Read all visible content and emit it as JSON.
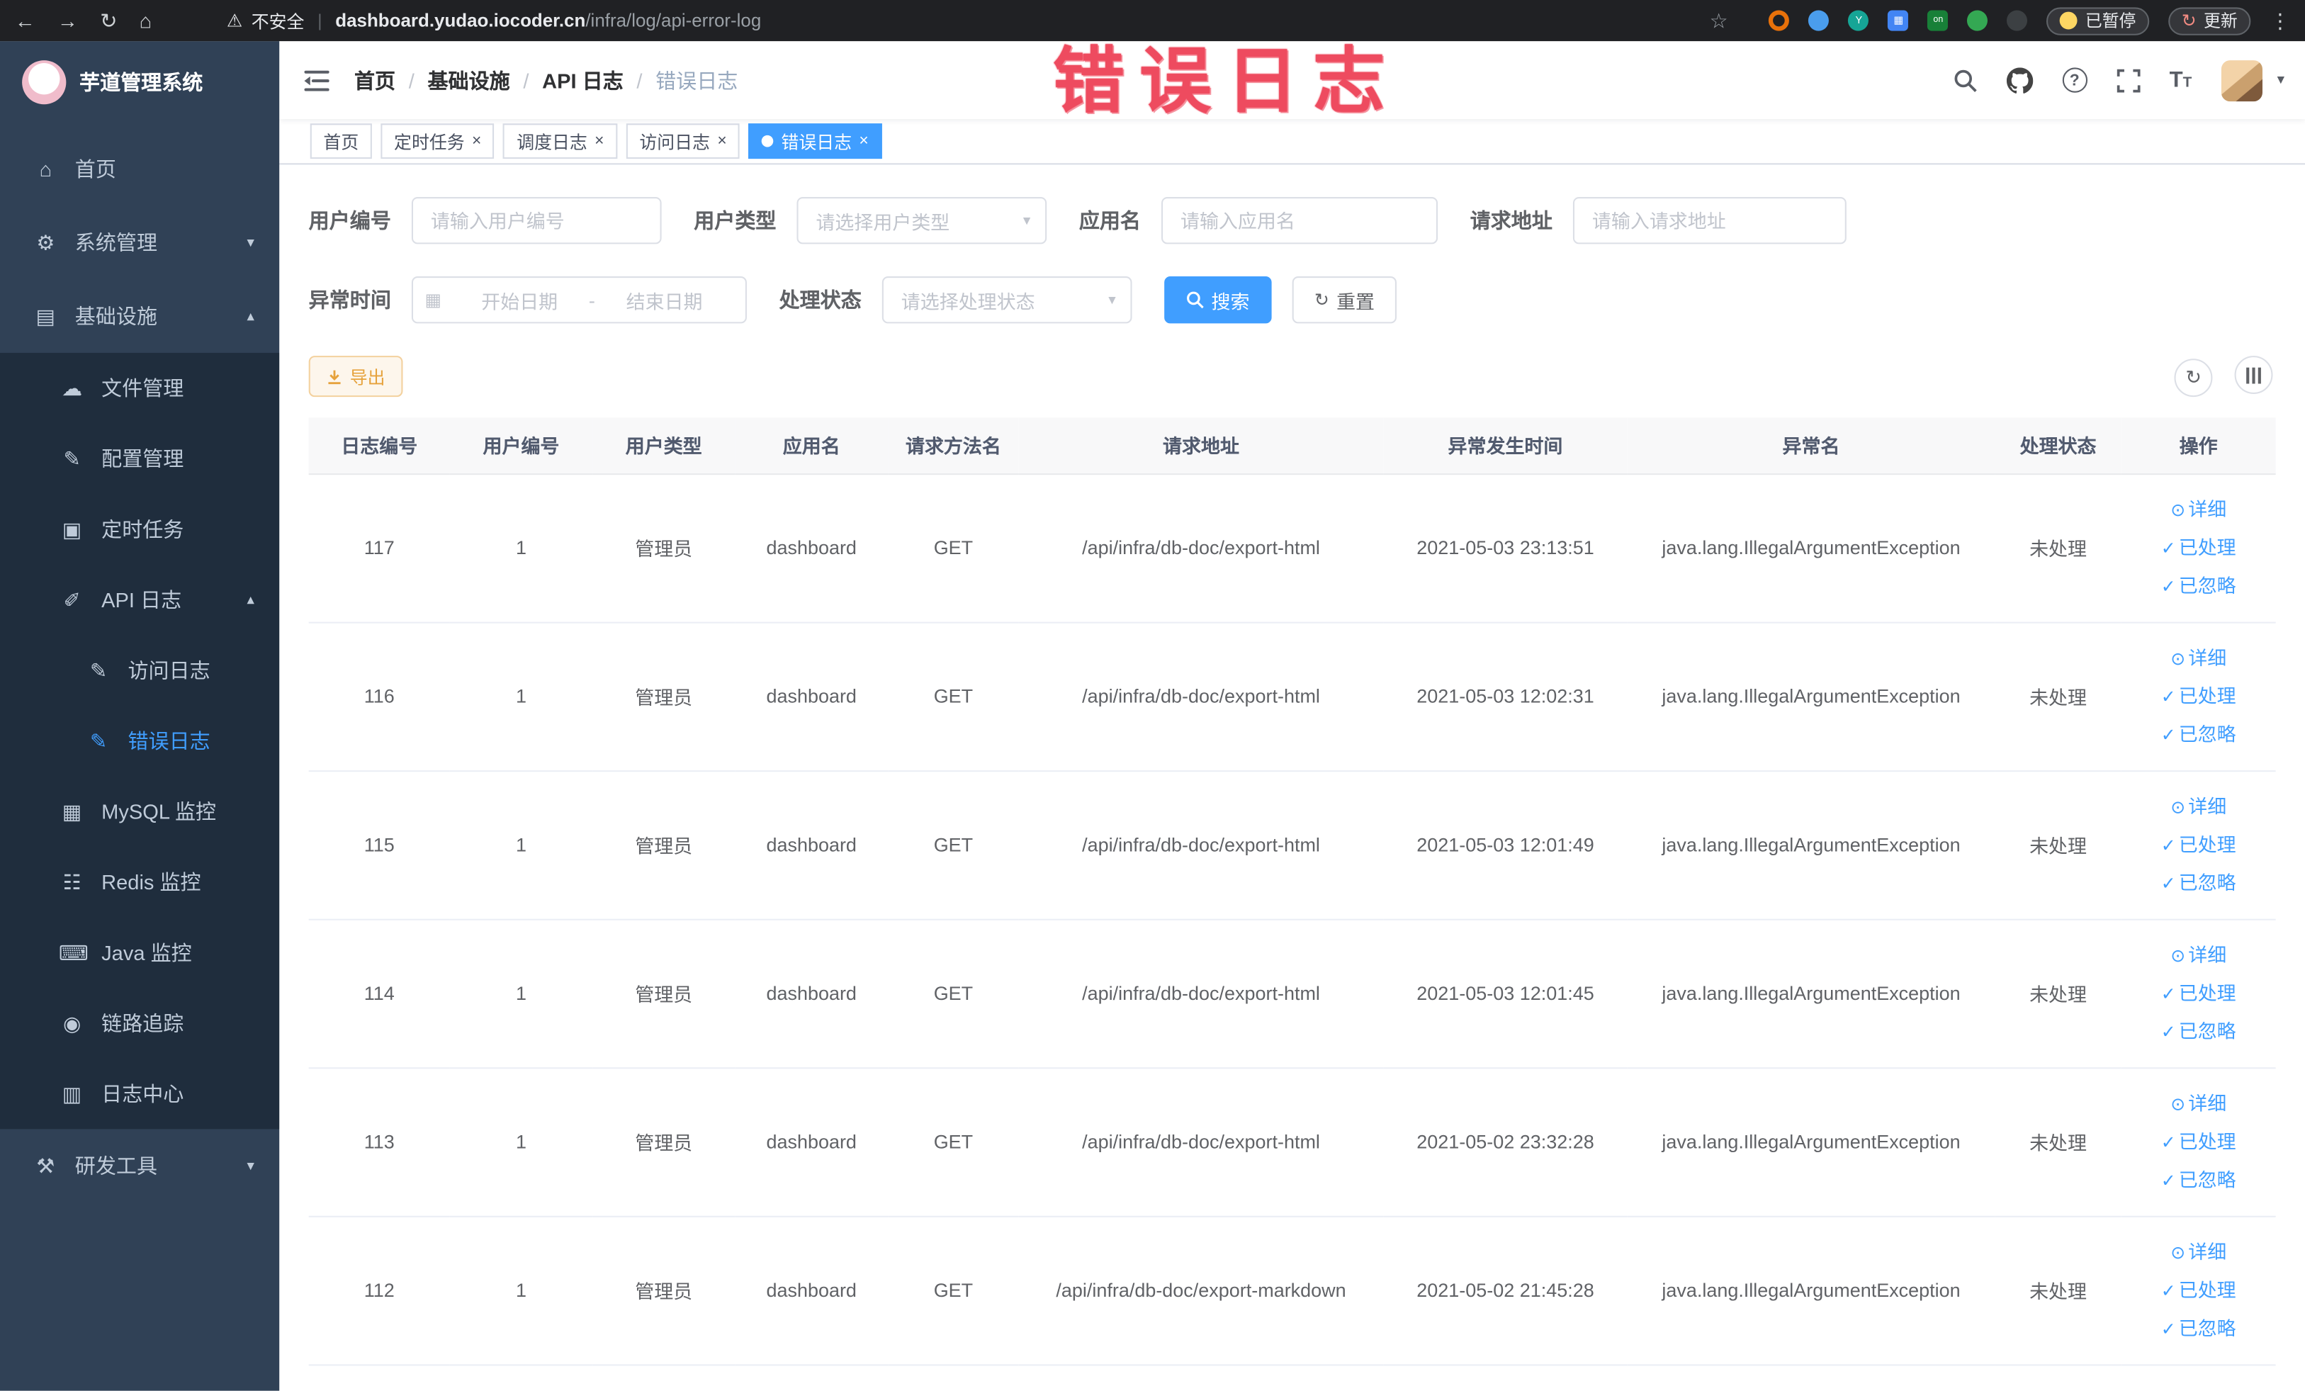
{
  "browser": {
    "security_label": "不安全",
    "url_host": "dashboard.yudao.iocoder.cn",
    "url_path": "/infra/log/api-error-log",
    "paused_badge": "已暂停",
    "update_label": "更新",
    "extension_on_badge": "on"
  },
  "annotation": {
    "text": "错误日志"
  },
  "sidebar": {
    "title": "芋道管理系统",
    "items": [
      {
        "label": "首页"
      },
      {
        "label": "系统管理"
      },
      {
        "label": "基础设施"
      },
      {
        "label": "文件管理"
      },
      {
        "label": "配置管理"
      },
      {
        "label": "定时任务"
      },
      {
        "label": "API 日志"
      },
      {
        "label": "访问日志"
      },
      {
        "label": "错误日志"
      },
      {
        "label": "MySQL 监控"
      },
      {
        "label": "Redis 监控"
      },
      {
        "label": "Java 监控"
      },
      {
        "label": "链路追踪"
      },
      {
        "label": "日志中心"
      },
      {
        "label": "研发工具"
      }
    ]
  },
  "header": {
    "breadcrumb": [
      "首页",
      "基础设施",
      "API 日志",
      "错误日志"
    ]
  },
  "tabs": [
    {
      "label": "首页"
    },
    {
      "label": "定时任务"
    },
    {
      "label": "调度日志"
    },
    {
      "label": "访问日志"
    },
    {
      "label": "错误日志"
    }
  ],
  "filters": {
    "user_id": {
      "label": "用户编号",
      "placeholder": "请输入用户编号"
    },
    "user_type": {
      "label": "用户类型",
      "placeholder": "请选择用户类型"
    },
    "app_name": {
      "label": "应用名",
      "placeholder": "请输入应用名"
    },
    "request_url": {
      "label": "请求地址",
      "placeholder": "请输入请求地址"
    },
    "exception_time": {
      "label": "异常时间",
      "start_placeholder": "开始日期",
      "separator": "-",
      "end_placeholder": "结束日期"
    },
    "process_status": {
      "label": "处理状态",
      "placeholder": "请选择处理状态"
    },
    "search_button": "搜索",
    "reset_button": "重置"
  },
  "toolbar": {
    "export_button": "导出"
  },
  "table": {
    "columns": [
      "日志编号",
      "用户编号",
      "用户类型",
      "应用名",
      "请求方法名",
      "请求地址",
      "异常发生时间",
      "异常名",
      "处理状态",
      "操作"
    ],
    "action_detail": "详细",
    "action_processed": "已处理",
    "action_ignored": "已忽略",
    "rows": [
      {
        "id": "117",
        "user_id": "1",
        "user_type": "管理员",
        "app": "dashboard",
        "method": "GET",
        "url": "/api/infra/db-doc/export-html",
        "time": "2021-05-03 23:13:51",
        "exception": "java.lang.IllegalArgumentException",
        "status": "未处理"
      },
      {
        "id": "116",
        "user_id": "1",
        "user_type": "管理员",
        "app": "dashboard",
        "method": "GET",
        "url": "/api/infra/db-doc/export-html",
        "time": "2021-05-03 12:02:31",
        "exception": "java.lang.IllegalArgumentException",
        "status": "未处理"
      },
      {
        "id": "115",
        "user_id": "1",
        "user_type": "管理员",
        "app": "dashboard",
        "method": "GET",
        "url": "/api/infra/db-doc/export-html",
        "time": "2021-05-03 12:01:49",
        "exception": "java.lang.IllegalArgumentException",
        "status": "未处理"
      },
      {
        "id": "114",
        "user_id": "1",
        "user_type": "管理员",
        "app": "dashboard",
        "method": "GET",
        "url": "/api/infra/db-doc/export-html",
        "time": "2021-05-03 12:01:45",
        "exception": "java.lang.IllegalArgumentException",
        "status": "未处理"
      },
      {
        "id": "113",
        "user_id": "1",
        "user_type": "管理员",
        "app": "dashboard",
        "method": "GET",
        "url": "/api/infra/db-doc/export-html",
        "time": "2021-05-02 23:32:28",
        "exception": "java.lang.IllegalArgumentException",
        "status": "未处理"
      },
      {
        "id": "112",
        "user_id": "1",
        "user_type": "管理员",
        "app": "dashboard",
        "method": "GET",
        "url": "/api/infra/db-doc/export-markdown",
        "time": "2021-05-02 21:45:28",
        "exception": "java.lang.IllegalArgumentException",
        "status": "未处理"
      }
    ]
  }
}
